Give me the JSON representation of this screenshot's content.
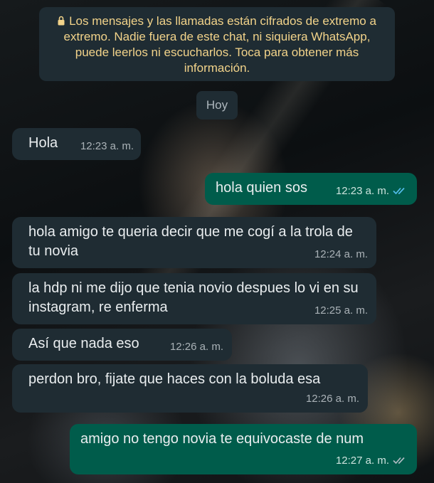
{
  "encryption_notice": "Los mensajes y las llamadas están cifrados de extremo a extremo. Nadie fuera de este chat, ni siquiera WhatsApp, puede leerlos ni escucharlos. Toca para obtener más información.",
  "date_chip": "Hoy",
  "messages": [
    {
      "direction": "incoming",
      "text": "Hola",
      "time": "12:23 a. m."
    },
    {
      "direction": "outgoing",
      "text": "hola quien sos",
      "time": "12:23 a. m.",
      "status": "read"
    },
    {
      "direction": "incoming",
      "text": "hola amigo te queria decir que me cogí a la trola de tu novia",
      "time": "12:24 a. m."
    },
    {
      "direction": "incoming",
      "text": "la hdp ni me dijo que tenia novio despues lo vi en su instagram, re enferma",
      "time": "12:25 a. m."
    },
    {
      "direction": "incoming",
      "text": "Así que nada eso",
      "time": "12:26 a. m."
    },
    {
      "direction": "incoming",
      "text": "perdon bro, fijate que haces con la boluda esa",
      "time": "12:26 a. m."
    },
    {
      "direction": "outgoing",
      "text": "amigo no tengo novia te equivocaste de num",
      "time": "12:27 a. m.",
      "status": "delivered"
    }
  ],
  "colors": {
    "incoming_bubble": "#1f2c33",
    "outgoing_bubble": "#005c4b",
    "read_ticks": "#53bdeb",
    "delivered_ticks": "#aebac1",
    "notice_text": "#f2d38a"
  }
}
